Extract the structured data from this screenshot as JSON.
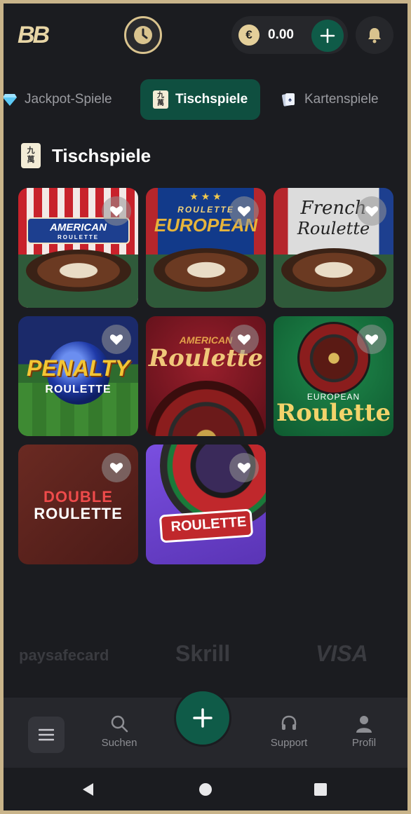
{
  "header": {
    "logo": "BB",
    "currency_symbol": "€",
    "balance": "0.00"
  },
  "tabs": [
    {
      "label": "Jackpot-Spiele",
      "icon": "diamond-icon",
      "active": false
    },
    {
      "label": "Tischspiele",
      "icon": "mahjong-tile-icon",
      "active": true
    },
    {
      "label": "Kartenspiele",
      "icon": "playing-cards-icon",
      "active": false
    }
  ],
  "section": {
    "title": "Tischspiele",
    "tile_glyph_top": "九",
    "tile_glyph_bottom": "萬"
  },
  "games": [
    {
      "title_line1": "AMERICAN",
      "title_line2": "ROULETTE"
    },
    {
      "title_line1": "ROULETTE",
      "title_line2": "EUROPEAN"
    },
    {
      "title_line1": "French",
      "title_line2": "Roulette"
    },
    {
      "title_line1": "PENALTY",
      "title_line2": "ROULETTE"
    },
    {
      "title_line1": "AMERICAN",
      "title_line2": "Roulette"
    },
    {
      "title_line1": "EUROPEAN",
      "title_line2": "Roulette"
    },
    {
      "title_line1": "DOUBLE",
      "title_line2": "ROULETTE"
    },
    {
      "title_line1": "ROULETTE"
    }
  ],
  "payments": [
    "paysafecard",
    "Skrill",
    "VISA"
  ],
  "bottom_nav": {
    "search": "Suchen",
    "support": "Support",
    "profile": "Profil"
  },
  "colors": {
    "accent_green": "#0f5b48",
    "gold": "#d9c38e",
    "background": "#1b1c20"
  }
}
